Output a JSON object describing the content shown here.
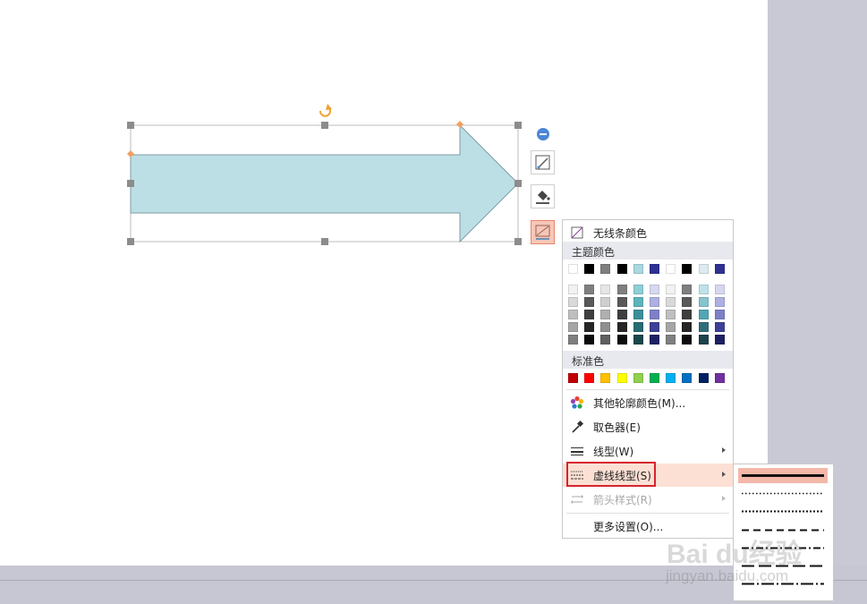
{
  "colors": {
    "arrow_fill": "#bcdfe5",
    "arrow_stroke": "#7f9aa3",
    "handle_gray": "#8c8c8c",
    "handle_orange": "#f0a060",
    "rotate_orange": "#f0a030",
    "menu_highlight": "#fde0d4",
    "annotation_red": "#d6242e"
  },
  "float_toolbar": [
    {
      "name": "collapse-icon"
    },
    {
      "name": "shape-style-icon"
    },
    {
      "name": "fill-bucket-icon"
    },
    {
      "name": "outline-icon",
      "active": true
    }
  ],
  "menu": {
    "no_line_color": "无线条颜色",
    "theme_colors_label": "主题颜色",
    "theme_colors_top": [
      "#ffffff",
      "#000000",
      "#7f7f7f",
      "#000000",
      "#a8d8e0",
      "#2e3192",
      "#ffffff",
      "#000000",
      "#ddebf0",
      "#2e3192"
    ],
    "theme_colors_shades": [
      [
        "#f2f2f2",
        "#7f7f7f",
        "#e6e6e6",
        "#7f7f7f",
        "#8ecfd6",
        "#d6d8f0",
        "#f2f2f2",
        "#7f7f7f",
        "#bfe2e8",
        "#d6d8f0"
      ],
      [
        "#d9d9d9",
        "#595959",
        "#cfcfcf",
        "#595959",
        "#5fb3bd",
        "#adb0e0",
        "#d9d9d9",
        "#595959",
        "#86c4ce",
        "#adb0e0"
      ],
      [
        "#bfbfbf",
        "#3f3f3f",
        "#afafaf",
        "#3f3f3f",
        "#3c8f99",
        "#7d80c8",
        "#bfbfbf",
        "#3f3f3f",
        "#52a6b3",
        "#7d80c8"
      ],
      [
        "#a6a6a6",
        "#262626",
        "#8f8f8f",
        "#262626",
        "#276b73",
        "#3d4096",
        "#a6a6a6",
        "#262626",
        "#2f6e78",
        "#3d4096"
      ],
      [
        "#7f7f7f",
        "#0c0c0c",
        "#5f5f5f",
        "#0c0c0c",
        "#1a474d",
        "#1e2064",
        "#7f7f7f",
        "#0c0c0c",
        "#1d434a",
        "#1e2064"
      ]
    ],
    "standard_colors_label": "标准色",
    "standard_colors": [
      "#c00000",
      "#ff0000",
      "#ffc000",
      "#ffff00",
      "#92d050",
      "#00b050",
      "#00b0f0",
      "#0070c0",
      "#002060",
      "#7030a0"
    ],
    "more_colors": "其他轮廓颜色(M)...",
    "eyedropper": "取色器(E)",
    "line_style": "线型(W)",
    "dash_style": "虚线线型(S)",
    "arrow_style": "箭头样式(R)",
    "more_settings": "更多设置(O)..."
  },
  "dash_styles": [
    {
      "name": "solid",
      "selected": true
    },
    {
      "name": "round-dot"
    },
    {
      "name": "square-dot"
    },
    {
      "name": "dash"
    },
    {
      "name": "dash-dot"
    },
    {
      "name": "long-dash"
    },
    {
      "name": "long-dash-dot"
    }
  ],
  "watermark": {
    "brand": "Bai du经验",
    "url": "jingyan.baidu.com"
  }
}
